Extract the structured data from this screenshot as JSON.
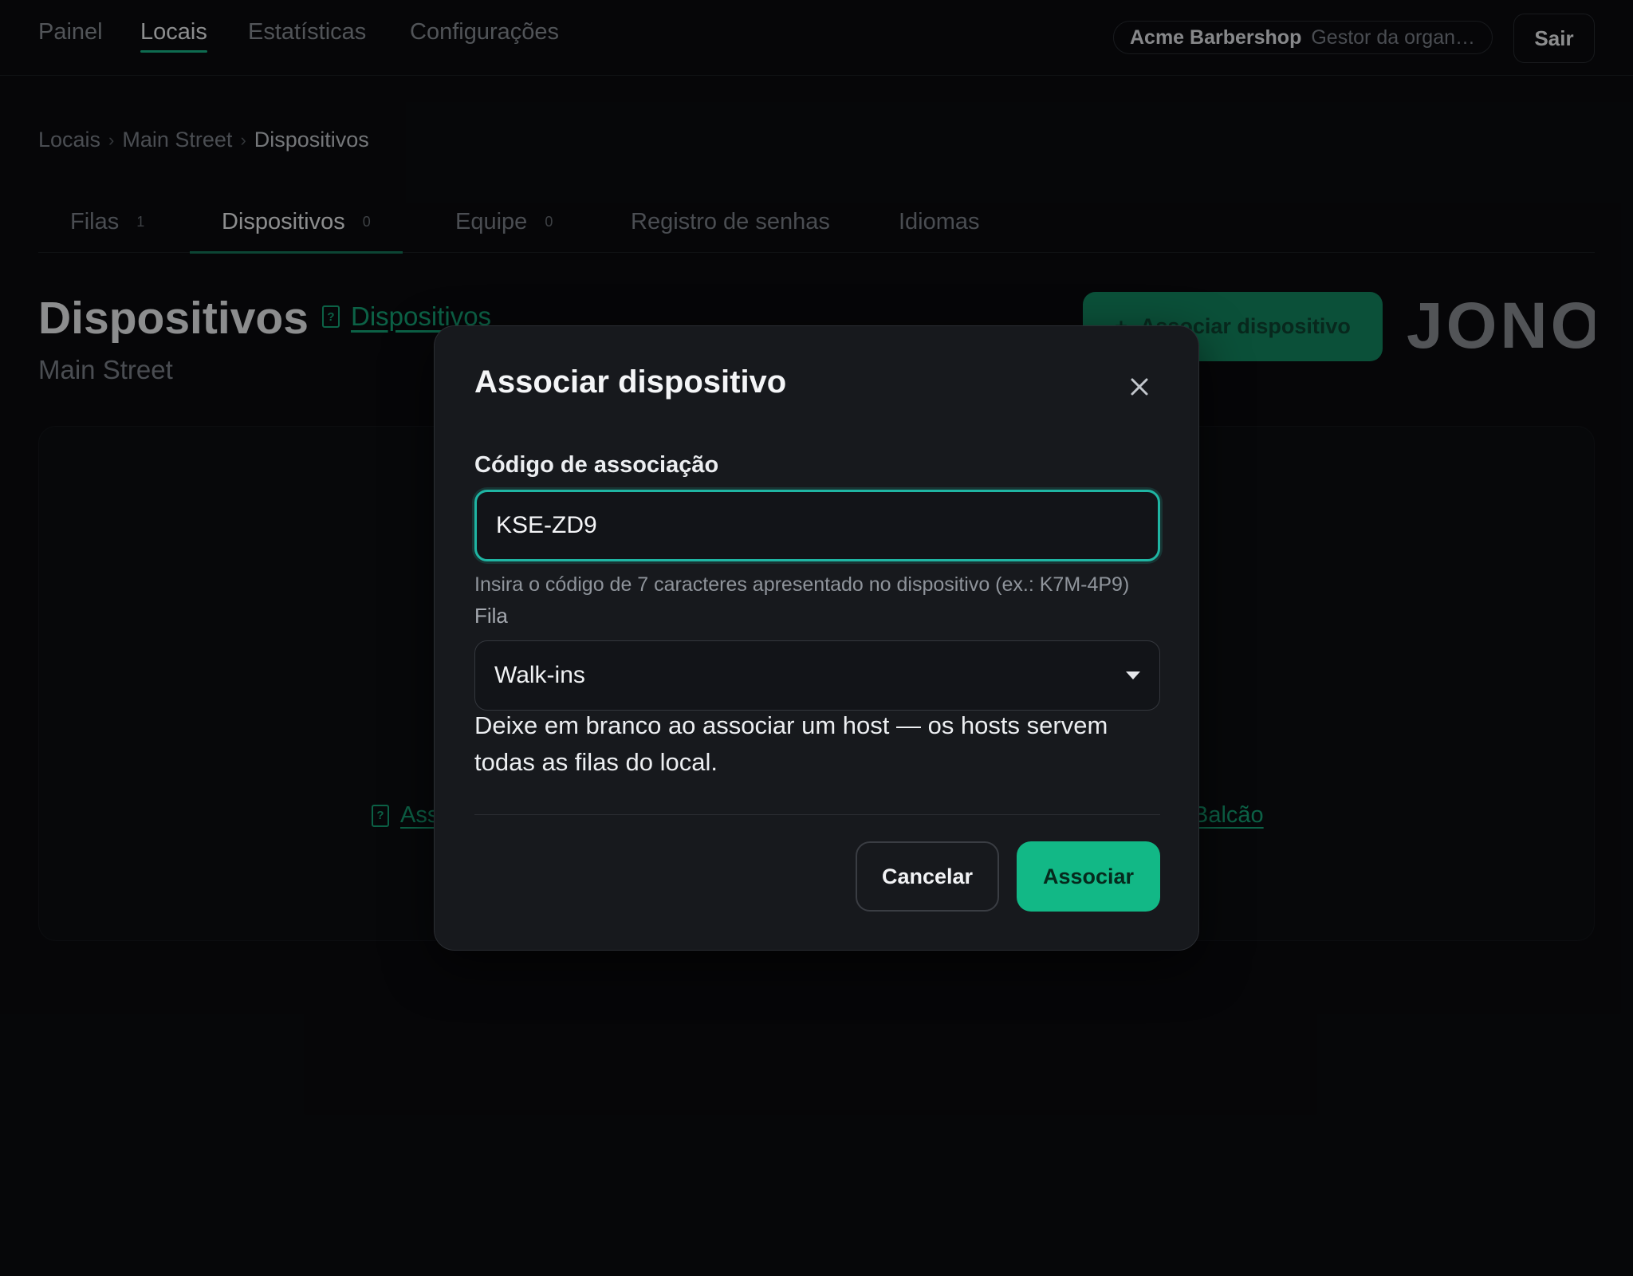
{
  "nav": {
    "items": [
      {
        "label": "Painel",
        "active": false
      },
      {
        "label": "Locais",
        "active": true
      },
      {
        "label": "Estatísticas",
        "active": false
      },
      {
        "label": "Configurações",
        "active": false
      }
    ],
    "org_name": "Acme Barbershop",
    "org_role": "Gestor da organi...",
    "logout_label": "Sair"
  },
  "breadcrumb": [
    "Locais",
    "Main Street",
    "Dispositivos"
  ],
  "tabs": [
    {
      "label": "Filas",
      "count": "1"
    },
    {
      "label": "Dispositivos",
      "count": "0",
      "active": true
    },
    {
      "label": "Equipe",
      "count": "0"
    },
    {
      "label": "Registro de senhas",
      "count": ""
    },
    {
      "label": "Idiomas",
      "count": ""
    }
  ],
  "page": {
    "title": "Dispositivos",
    "docs_link": "Dispositivos",
    "subtitle": "Main Street",
    "associate_button": "Associar dispositivo",
    "associate_icon": "plus-icon",
    "brand": "JONOT"
  },
  "background": {
    "link_left": "Ass",
    "link_right": "Balcão"
  },
  "modal": {
    "title": "Associar dispositivo",
    "code_label": "Código de associação",
    "code_value": "KSE-ZD9",
    "code_hint": "Insira o código de 7 caracteres apresentado no dispositivo (ex.: K7M-4P9)",
    "queue_label": "Fila",
    "queue_value": "Walk-ins",
    "queue_help": "Deixe em branco ao associar um host — os hosts servem todas as filas do local.",
    "cancel_label": "Cancelar",
    "submit_label": "Associar"
  },
  "colors": {
    "accent": "#12b886",
    "focus_ring": "#1fb5a3",
    "background": "#0b0c0f",
    "modal": "#17191d"
  }
}
